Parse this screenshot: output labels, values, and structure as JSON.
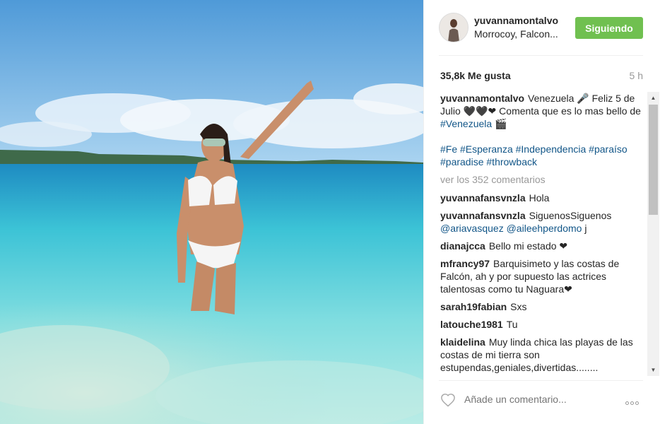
{
  "post": {
    "username": "yuvannamontalvo",
    "location": "Morrocoy, Falcon...",
    "follow_label": "Siguiendo",
    "likes": "35,8k Me gusta",
    "time": "5 h"
  },
  "caption": {
    "user": "yuvannamontalvo",
    "text_part1": "Venezuela 🎤 Feliz 5 de Julio 🖤🖤❤ Comenta que es lo mas bello de ",
    "hashtag": "#Venezuela",
    "text_part2": " 🎬",
    "tags": [
      "#Fe",
      "#Esperanza",
      "#Independencia",
      "#paraíso",
      "#paradise",
      "#throwback"
    ]
  },
  "view_all_comments": "ver los 352 comentarios",
  "comments": [
    {
      "user": "yuvannafansvnzla",
      "text": "Hola"
    },
    {
      "user": "yuvannafansvnzla",
      "text": "SiguenosSiguenos",
      "mentions": [
        "@ariavasquez",
        "@aileehperdomo"
      ],
      "tail": "j"
    },
    {
      "user": "dianajcca",
      "text": "Bello mi estado ❤"
    },
    {
      "user": "mfrancy97",
      "text": "Barquisimeto y las costas de Falcón, ah y por supuesto las actrices talentosas como tu Naguara❤"
    },
    {
      "user": "sarah19fabian",
      "text": "Sxs"
    },
    {
      "user": "latouche1981",
      "text": "Tu"
    },
    {
      "user": "klaidelina",
      "text": "Muy linda chica las playas de las costas de mi tierra son estupendas,geniales,divertidas........"
    }
  ],
  "composer": {
    "placeholder": "Añade un comentario..."
  },
  "icons": {
    "like": "heart-outline-icon",
    "more": "more-options-icon"
  },
  "colors": {
    "follow_button": "#70c050",
    "link": "#125688",
    "muted": "#999999"
  }
}
